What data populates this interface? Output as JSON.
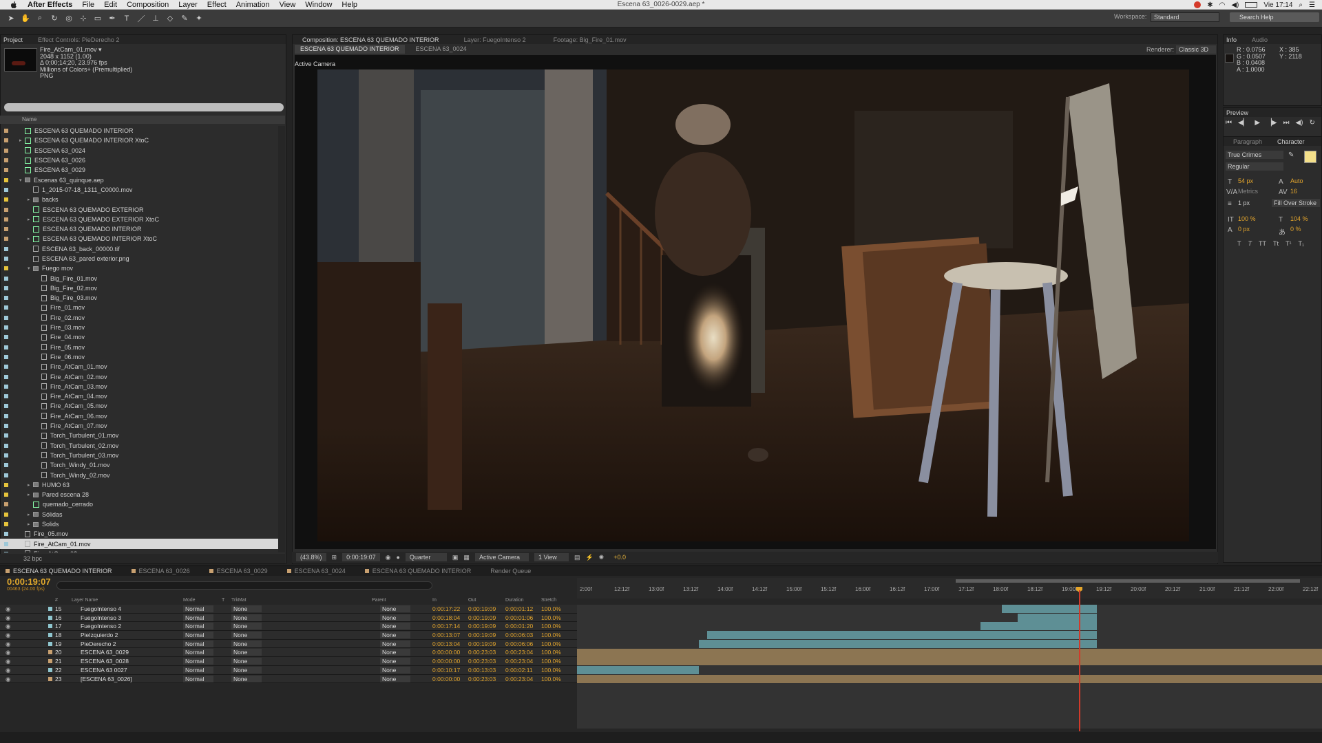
{
  "menubar": {
    "app": "After Effects",
    "items": [
      "File",
      "Edit",
      "Composition",
      "Layer",
      "Effect",
      "Animation",
      "View",
      "Window",
      "Help"
    ],
    "doc_title": "Escena 63_0026-0029.aep *",
    "clock": "Vie 17:14"
  },
  "toolbar": {
    "workspace_label": "Workspace:",
    "workspace_value": "Standard",
    "search_help": "Search Help"
  },
  "project": {
    "tabs": [
      "Project",
      "Effect Controls: PieDerecho 2"
    ],
    "selected_name": "Fire_AtCam_01.mov ▾",
    "selected_dims": "2048 x 1152 (1.00)",
    "selected_duration": "Δ 0;00;14;20, 23.976 fps",
    "selected_colors": "Millions of Colors+ (Premultiplied)",
    "selected_format": "PNG",
    "col_name": "Name",
    "items": [
      {
        "name": "ESCENA 63 QUEMADO INTERIOR",
        "d": 0,
        "t": "comp",
        "c": "#c8a070"
      },
      {
        "name": "ESCENA 63 QUEMADO INTERIOR XtoC",
        "d": 0,
        "t": "comp",
        "c": "#c8a070",
        "a": "▸"
      },
      {
        "name": "ESCENA 63_0024",
        "d": 0,
        "t": "comp",
        "c": "#c8a070"
      },
      {
        "name": "ESCENA 63_0026",
        "d": 0,
        "t": "comp",
        "c": "#c8a070"
      },
      {
        "name": "ESCENA 63_0029",
        "d": 0,
        "t": "comp",
        "c": "#c8a070"
      },
      {
        "name": "Escenas 63_quinque.aep",
        "d": 0,
        "t": "folder",
        "c": "#e6c43c",
        "a": "▾"
      },
      {
        "name": "1_2015-07-18_1311_C0000.mov",
        "d": 1,
        "t": "file",
        "c": "#9ec8d8"
      },
      {
        "name": "backs",
        "d": 1,
        "t": "folder",
        "c": "#e6c43c",
        "a": "▸"
      },
      {
        "name": "ESCENA 63 QUEMADO EXTERIOR",
        "d": 1,
        "t": "comp",
        "c": "#c8a070"
      },
      {
        "name": "ESCENA 63 QUEMADO EXTERIOR XtoC",
        "d": 1,
        "t": "comp",
        "c": "#c8a070",
        "a": "▸"
      },
      {
        "name": "ESCENA 63 QUEMADO INTERIOR",
        "d": 1,
        "t": "comp",
        "c": "#c8a070"
      },
      {
        "name": "ESCENA 63 QUEMADO INTERIOR XtoC",
        "d": 1,
        "t": "comp",
        "c": "#c8a070",
        "a": "▸"
      },
      {
        "name": "ESCENA 63_back_00000.tif",
        "d": 1,
        "t": "file",
        "c": "#9ec8d8"
      },
      {
        "name": "ESCENA 63_pared exterior.png",
        "d": 1,
        "t": "file",
        "c": "#9ec8d8"
      },
      {
        "name": "Fuego mov",
        "d": 1,
        "t": "folder",
        "c": "#e6c43c",
        "a": "▾"
      },
      {
        "name": "Big_Fire_01.mov",
        "d": 2,
        "t": "file",
        "c": "#9ec8d8"
      },
      {
        "name": "Big_Fire_02.mov",
        "d": 2,
        "t": "file",
        "c": "#9ec8d8"
      },
      {
        "name": "Big_Fire_03.mov",
        "d": 2,
        "t": "file",
        "c": "#9ec8d8"
      },
      {
        "name": "Fire_01.mov",
        "d": 2,
        "t": "file",
        "c": "#9ec8d8"
      },
      {
        "name": "Fire_02.mov",
        "d": 2,
        "t": "file",
        "c": "#9ec8d8"
      },
      {
        "name": "Fire_03.mov",
        "d": 2,
        "t": "file",
        "c": "#9ec8d8"
      },
      {
        "name": "Fire_04.mov",
        "d": 2,
        "t": "file",
        "c": "#9ec8d8"
      },
      {
        "name": "Fire_05.mov",
        "d": 2,
        "t": "file",
        "c": "#9ec8d8"
      },
      {
        "name": "Fire_06.mov",
        "d": 2,
        "t": "file",
        "c": "#9ec8d8"
      },
      {
        "name": "Fire_AtCam_01.mov",
        "d": 2,
        "t": "file",
        "c": "#9ec8d8"
      },
      {
        "name": "Fire_AtCam_02.mov",
        "d": 2,
        "t": "file",
        "c": "#9ec8d8"
      },
      {
        "name": "Fire_AtCam_03.mov",
        "d": 2,
        "t": "file",
        "c": "#9ec8d8"
      },
      {
        "name": "Fire_AtCam_04.mov",
        "d": 2,
        "t": "file",
        "c": "#9ec8d8"
      },
      {
        "name": "Fire_AtCam_05.mov",
        "d": 2,
        "t": "file",
        "c": "#9ec8d8"
      },
      {
        "name": "Fire_AtCam_06.mov",
        "d": 2,
        "t": "file",
        "c": "#9ec8d8"
      },
      {
        "name": "Fire_AtCam_07.mov",
        "d": 2,
        "t": "file",
        "c": "#9ec8d8"
      },
      {
        "name": "Torch_Turbulent_01.mov",
        "d": 2,
        "t": "file",
        "c": "#9ec8d8"
      },
      {
        "name": "Torch_Turbulent_02.mov",
        "d": 2,
        "t": "file",
        "c": "#9ec8d8"
      },
      {
        "name": "Torch_Turbulent_03.mov",
        "d": 2,
        "t": "file",
        "c": "#9ec8d8"
      },
      {
        "name": "Torch_Windy_01.mov",
        "d": 2,
        "t": "file",
        "c": "#9ec8d8"
      },
      {
        "name": "Torch_Windy_02.mov",
        "d": 2,
        "t": "file",
        "c": "#9ec8d8"
      },
      {
        "name": "HUMO 63",
        "d": 1,
        "t": "folder",
        "c": "#e6c43c",
        "a": "▸"
      },
      {
        "name": "Pared escena 28",
        "d": 1,
        "t": "folder",
        "c": "#e6c43c",
        "a": "▸"
      },
      {
        "name": "quemado_cerrado",
        "d": 1,
        "t": "comp",
        "c": "#c8a070"
      },
      {
        "name": "Sólidas",
        "d": 1,
        "t": "folder",
        "c": "#e6c43c",
        "a": "▸"
      },
      {
        "name": "Solids",
        "d": 1,
        "t": "folder",
        "c": "#e6c43c",
        "a": "▸"
      },
      {
        "name": "Fire_05.mov",
        "d": 0,
        "t": "file",
        "c": "#9ec8d8"
      },
      {
        "name": "Fire_AtCam_01.mov",
        "d": 0,
        "t": "file",
        "c": "#9ec8d8",
        "sel": true
      },
      {
        "name": "Fire_AtCam_0?.mov",
        "d": 0,
        "t": "file",
        "c": "#9ec8d8"
      }
    ],
    "bpc": "32 bpc"
  },
  "composition": {
    "tabs": [
      "Composition: ESCENA 63 QUEMADO INTERIOR",
      "Layer: FuegoIntenso 2",
      "Footage: Big_Fire_01.mov"
    ],
    "crumbs": [
      "ESCENA 63 QUEMADO INTERIOR",
      "ESCENA 63_0024"
    ],
    "renderer_label": "Renderer:",
    "renderer_value": "Classic 3D",
    "active_camera": "Active Camera",
    "footer": {
      "zoom": "(43.8%)",
      "time": "0:00:19:07",
      "resolution": "Quarter",
      "view": "Active Camera",
      "views": "1 View",
      "exposure": "+0.0"
    }
  },
  "info": {
    "tabs": [
      "Info",
      "Audio"
    ],
    "r": "R : 0.0756",
    "g": "G : 0.0507",
    "b": "B : 0.0408",
    "a": "A : 1.0000",
    "x": "X : 385",
    "y": "Y : 2118",
    "swatch": "#161210"
  },
  "preview": {
    "title": "Preview"
  },
  "character": {
    "tabs": [
      "Paragraph",
      "Character"
    ],
    "font": "True Crimes",
    "style": "Regular",
    "size": "54 px",
    "leading": "Auto",
    "kerning": "Metrics",
    "tracking": "16",
    "stroke": "1 px",
    "stroke_mode": "Fill Over Stroke",
    "vscale": "100 %",
    "hscale": "104 %",
    "baseline": "0 px",
    "tsume": "0 %",
    "fill_color": "#f4e08a"
  },
  "timeline": {
    "tabs": [
      "ESCENA 63 QUEMADO INTERIOR",
      "ESCENA 63_0026",
      "ESCENA 63_0029",
      "ESCENA 63_0024",
      "ESCENA 63 QUEMADO INTERIOR",
      "Render Queue"
    ],
    "timecode": "0:00:19:07",
    "fps": "00463 (24.00 fps)",
    "cols": {
      "num": "#",
      "name": "Layer Name",
      "mode": "Mode",
      "t": "T",
      "trkmat": "TrkMat",
      "parent": "Parent",
      "in": "In",
      "out": "Out",
      "duration": "Duration",
      "stretch": "Stretch"
    },
    "ticks": [
      "2:00f",
      "12:12f",
      "13:00f",
      "13:12f",
      "14:00f",
      "14:12f",
      "15:00f",
      "15:12f",
      "16:00f",
      "16:12f",
      "17:00f",
      "17:12f",
      "18:00f",
      "18:12f",
      "19:00f",
      "19:12f",
      "20:00f",
      "20:12f",
      "21:00f",
      "21:12f",
      "22:00f",
      "22:12f"
    ],
    "layers": [
      {
        "num": "15",
        "name": "FuegoIntenso 4",
        "mode": "Normal",
        "trk": "None",
        "parent": "None",
        "in": "0:00:17:22",
        "out": "0:00:19:09",
        "dur": "0:00:01:12",
        "stretch": "100.0%",
        "color": "#8fc6cf"
      },
      {
        "num": "16",
        "name": "FuegoIntenso 3",
        "mode": "Normal",
        "trk": "None",
        "parent": "None",
        "in": "0:00:18:04",
        "out": "0:00:19:09",
        "dur": "0:00:01:06",
        "stretch": "100.0%",
        "color": "#8fc6cf"
      },
      {
        "num": "17",
        "name": "FuegoIntenso 2",
        "mode": "Normal",
        "trk": "None",
        "parent": "None",
        "in": "0:00:17:14",
        "out": "0:00:19:09",
        "dur": "0:00:01:20",
        "stretch": "100.0%",
        "color": "#8fc6cf"
      },
      {
        "num": "18",
        "name": "PieIzquierdo 2",
        "mode": "Normal",
        "trk": "None",
        "parent": "None",
        "in": "0:00:13:07",
        "out": "0:00:19:09",
        "dur": "0:00:06:03",
        "stretch": "100.0%",
        "color": "#8fc6cf"
      },
      {
        "num": "19",
        "name": "PieDerecho 2",
        "mode": "Normal",
        "trk": "None",
        "parent": "None",
        "in": "0:00:13:04",
        "out": "0:00:19:09",
        "dur": "0:00:06:06",
        "stretch": "100.0%",
        "color": "#8fc6cf"
      },
      {
        "num": "20",
        "name": "ESCENA 63_0029",
        "mode": "Normal",
        "trk": "None",
        "parent": "None",
        "in": "0:00:00:00",
        "out": "0:00:23:03",
        "dur": "0:00:23:04",
        "stretch": "100.0%",
        "color": "#c8a070"
      },
      {
        "num": "21",
        "name": "ESCENA 63_0028",
        "mode": "Normal",
        "trk": "None",
        "parent": "None",
        "in": "0:00:00:00",
        "out": "0:00:23:03",
        "dur": "0:00:23:04",
        "stretch": "100.0%",
        "color": "#c8a070"
      },
      {
        "num": "22",
        "name": "ESCENA 63 0027",
        "mode": "Normal",
        "trk": "None",
        "parent": "None",
        "in": "0:00:10:17",
        "out": "0:00:13:03",
        "dur": "0:00:02:11",
        "stretch": "100.0%",
        "color": "#8fc6cf"
      },
      {
        "num": "23",
        "name": "[ESCENA 63_0026]",
        "mode": "Normal",
        "trk": "None",
        "parent": "None",
        "in": "0:00:00:00",
        "out": "0:00:23:03",
        "dur": "0:00:23:04",
        "stretch": "100.0%",
        "color": "#c8a070"
      }
    ]
  }
}
